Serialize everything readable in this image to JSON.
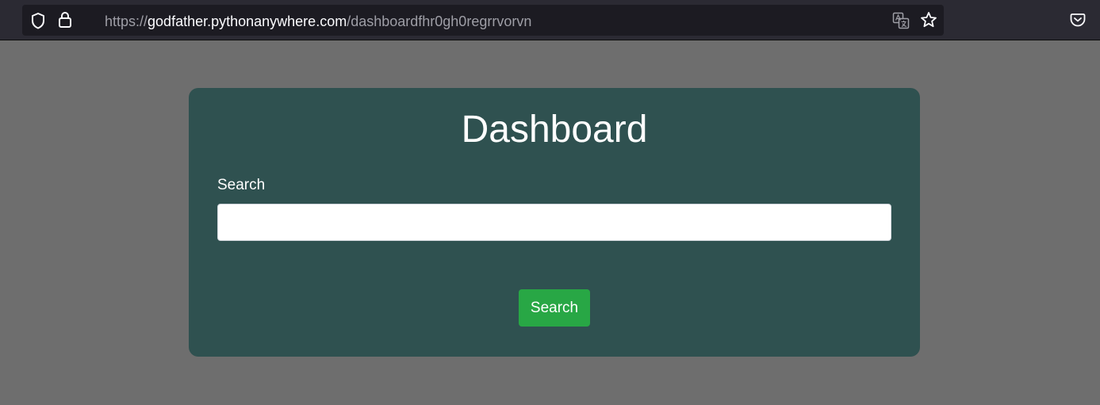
{
  "browser": {
    "url_scheme": "https://",
    "url_domain": "godfather.pythonanywhere.com",
    "url_path": "/dashboardfhr0gh0regrrvorvn",
    "icons": [
      "shield-icon",
      "lock-icon",
      "translate-icon",
      "bookmark-star-icon",
      "pocket-icon"
    ]
  },
  "dashboard": {
    "title": "Dashboard",
    "search_label": "Search",
    "search_value": "",
    "search_placeholder": "",
    "submit_label": "Search"
  },
  "colors": {
    "page_background": "#6e6e6e",
    "card_background": "#2f5150",
    "button_background": "#28a745",
    "toolbar_background": "#2b2a33"
  }
}
